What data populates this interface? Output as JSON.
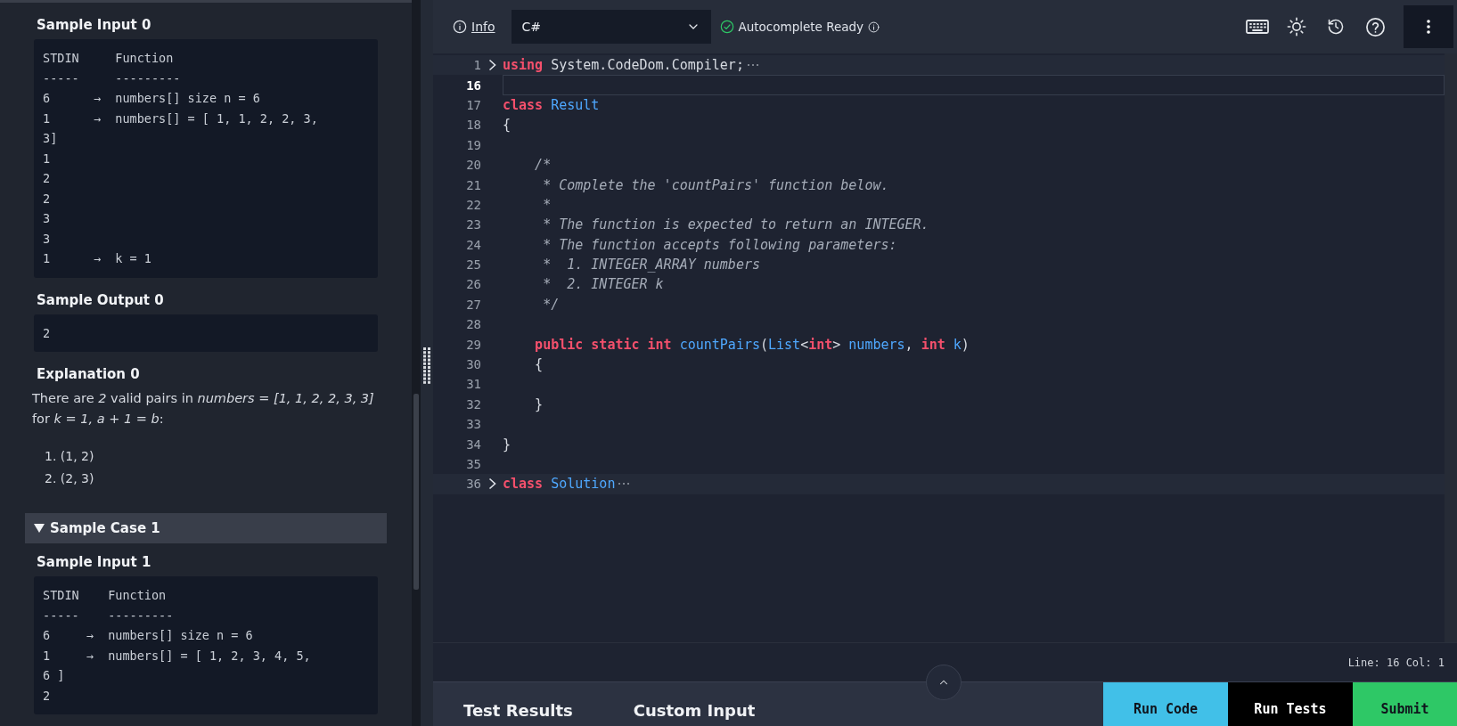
{
  "problem_panel": {
    "sections": [
      {
        "kind": "block",
        "title": "Sample Input 0",
        "lines": [
          "STDIN     Function",
          "-----     ---------",
          "6      →  numbers[] size n = 6",
          "1      →  numbers[] = [ 1, 1, 2, 2, 3,",
          "3]",
          "1",
          "2",
          "2",
          "3",
          "3",
          "1      →  k = 1"
        ]
      },
      {
        "kind": "block",
        "title": "Sample Output 0",
        "lines": [
          "2"
        ]
      },
      {
        "kind": "explanation",
        "title": "Explanation 0",
        "text": "There are *2* valid pairs in *numbers = [1, 1, 2, 2, 3, 3]* for *k = 1, a + 1 = b*:",
        "items": [
          "1. (1, 2)",
          "2. (2, 3)"
        ]
      },
      {
        "kind": "case",
        "title": "Sample Case 1",
        "expanded": true
      },
      {
        "kind": "block",
        "title": "Sample Input 1",
        "lines": [
          "STDIN    Function",
          "-----    ---------",
          "6     →  numbers[] size n = 6",
          "1     →  numbers[] = [ 1, 2, 3, 4, 5,",
          "6 ]",
          "2"
        ]
      }
    ]
  },
  "toolbar": {
    "info_link": "Info",
    "language": "C#",
    "autocomplete": "Autocomplete Ready"
  },
  "editor": {
    "lines": [
      {
        "number": "1",
        "folded": true,
        "current": false,
        "tokens": [
          {
            "kind": "keyword",
            "text": "using"
          },
          {
            "kind": "plain",
            "text": " System.CodeDom.Compiler;"
          }
        ]
      },
      {
        "number": "16",
        "folded": false,
        "current": true
      },
      {
        "number": "17",
        "folded": false,
        "current": false,
        "tokens": [
          {
            "kind": "keyword",
            "text": "class"
          },
          {
            "kind": "type",
            "text": " Result"
          }
        ]
      },
      {
        "number": "18",
        "folded": false,
        "current": false,
        "tokens": [
          {
            "kind": "plain",
            "text": "{"
          }
        ]
      },
      {
        "number": "19",
        "folded": false,
        "current": false
      },
      {
        "number": "20",
        "folded": false,
        "current": false,
        "tokens": [
          {
            "kind": "comment",
            "text": "    /*"
          }
        ]
      },
      {
        "number": "21",
        "folded": false,
        "current": false,
        "tokens": [
          {
            "kind": "comment",
            "text": "     * Complete the 'countPairs' function below."
          }
        ]
      },
      {
        "number": "22",
        "folded": false,
        "current": false,
        "tokens": [
          {
            "kind": "comment",
            "text": "     *"
          }
        ]
      },
      {
        "number": "23",
        "folded": false,
        "current": false,
        "tokens": [
          {
            "kind": "comment",
            "text": "     * The function is expected to return an INTEGER."
          }
        ]
      },
      {
        "number": "24",
        "folded": false,
        "current": false,
        "tokens": [
          {
            "kind": "comment",
            "text": "     * The function accepts following parameters:"
          }
        ]
      },
      {
        "number": "25",
        "folded": false,
        "current": false,
        "tokens": [
          {
            "kind": "comment",
            "text": "     *  1. INTEGER_ARRAY numbers"
          }
        ]
      },
      {
        "number": "26",
        "folded": false,
        "current": false,
        "tokens": [
          {
            "kind": "comment",
            "text": "     *  2. INTEGER k"
          }
        ]
      },
      {
        "number": "27",
        "folded": false,
        "current": false,
        "tokens": [
          {
            "kind": "comment",
            "text": "     */"
          }
        ]
      },
      {
        "number": "28",
        "folded": false,
        "current": false
      },
      {
        "number": "29",
        "folded": false,
        "current": false,
        "tokens": [
          {
            "kind": "keyword",
            "text": "    public static int"
          },
          {
            "kind": "type",
            "text": " countPairs"
          },
          {
            "kind": "plain",
            "text": "("
          },
          {
            "kind": "type",
            "text": "List"
          },
          {
            "kind": "plain",
            "text": "<"
          },
          {
            "kind": "keyword",
            "text": "int"
          },
          {
            "kind": "plain",
            "text": "> "
          },
          {
            "kind": "type",
            "text": "numbers"
          },
          {
            "kind": "plain",
            "text": ", "
          },
          {
            "kind": "keyword",
            "text": "int"
          },
          {
            "kind": "type",
            "text": " k"
          },
          {
            "kind": "plain",
            "text": ")"
          }
        ]
      },
      {
        "number": "30",
        "folded": false,
        "current": false,
        "tokens": [
          {
            "kind": "plain",
            "text": "    {"
          }
        ]
      },
      {
        "number": "31",
        "folded": false,
        "current": false
      },
      {
        "number": "32",
        "folded": false,
        "current": false,
        "tokens": [
          {
            "kind": "plain",
            "text": "    }"
          }
        ]
      },
      {
        "number": "33",
        "folded": false,
        "current": false
      },
      {
        "number": "34",
        "folded": false,
        "current": false,
        "tokens": [
          {
            "kind": "plain",
            "text": "}"
          }
        ]
      },
      {
        "number": "35",
        "folded": false,
        "current": false
      },
      {
        "number": "36",
        "folded": true,
        "current": false,
        "tokens": [
          {
            "kind": "keyword",
            "text": "class"
          },
          {
            "kind": "type",
            "text": " Solution"
          }
        ]
      }
    ],
    "status": "Line: 16 Col: 1"
  },
  "bottom_bar": {
    "tabs": [
      {
        "label": "Test Results",
        "selected": false
      },
      {
        "label": "Custom Input",
        "selected": false
      }
    ],
    "buttons": [
      {
        "kind": "run",
        "label": "Run Code"
      },
      {
        "kind": "tests",
        "label": "Run Tests"
      },
      {
        "kind": "submit",
        "label": "Submit"
      }
    ]
  }
}
